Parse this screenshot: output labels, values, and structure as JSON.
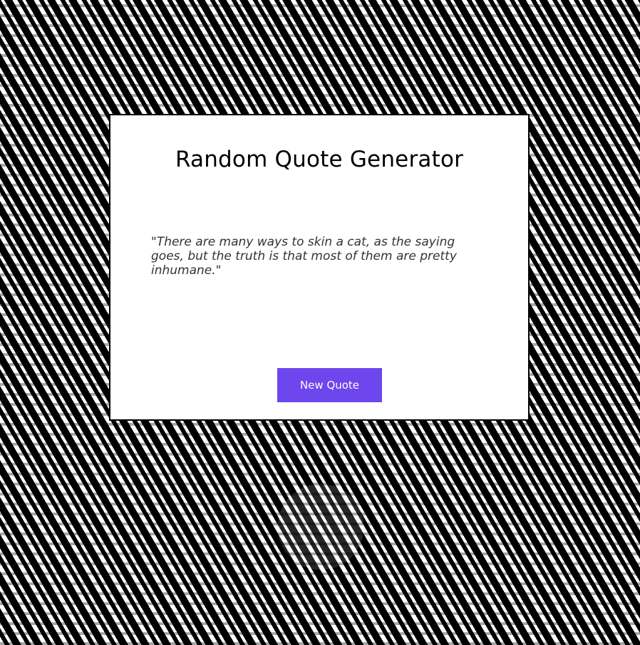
{
  "app": {
    "title": "Random Quote Generator"
  },
  "quote": {
    "text": "\"There are many ways to skin a cat, as the saying goes, but the truth is that most of them are pretty inhumane.\""
  },
  "actions": {
    "new_quote_label": "New Quote"
  },
  "colors": {
    "button_bg": "#6e46ee",
    "card_bg": "#ffffff",
    "background_primary": "#000000",
    "background_secondary": "#ffffff"
  }
}
